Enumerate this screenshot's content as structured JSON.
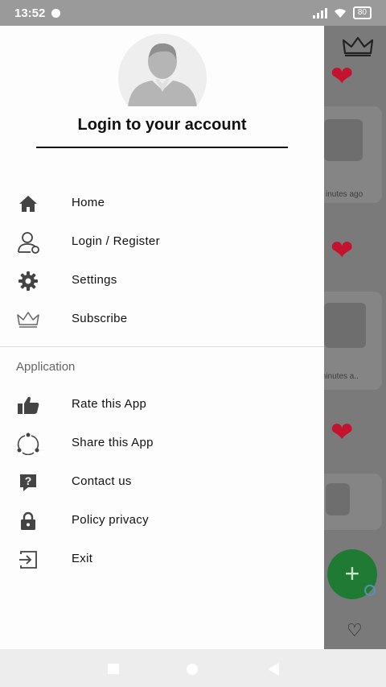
{
  "status_bar": {
    "time": "13:52",
    "battery": "80"
  },
  "drawer": {
    "header": {
      "title": "Login to your account"
    },
    "items": [
      {
        "label": "Home",
        "icon": "home-icon"
      },
      {
        "label": "Login / Register",
        "icon": "user-login-icon"
      },
      {
        "label": "Settings",
        "icon": "gear-icon"
      },
      {
        "label": "Subscribe",
        "icon": "crown-icon"
      }
    ],
    "section_title": "Application",
    "app_items": [
      {
        "label": "Rate this App",
        "icon": "thumbs-up-icon"
      },
      {
        "label": "Share this App",
        "icon": "share-icon"
      },
      {
        "label": "Contact us",
        "icon": "help-icon"
      },
      {
        "label": "Policy privacy",
        "icon": "lock-icon"
      },
      {
        "label": "Exit",
        "icon": "exit-icon"
      }
    ]
  },
  "background": {
    "card_times": [
      "inutes ago",
      "minutes a.."
    ],
    "colors": {
      "heart": "#c4122f",
      "fab": "#1f7a34"
    }
  }
}
